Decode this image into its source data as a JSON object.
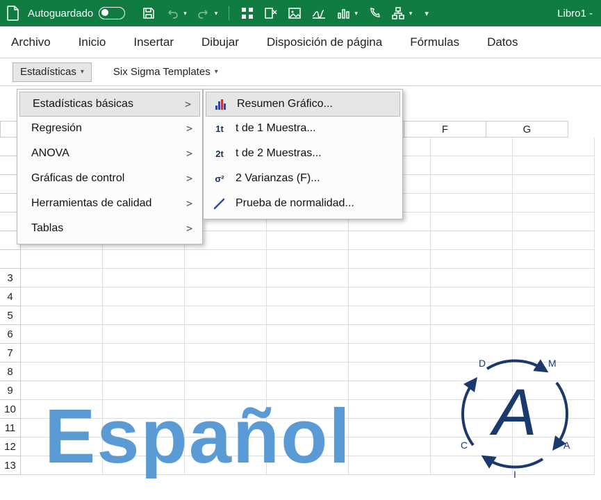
{
  "titlebar": {
    "autosave_label": "Autoguardado",
    "doc_title": "Libro1 -"
  },
  "ribbon_tabs": [
    "Archivo",
    "Inicio",
    "Insertar",
    "Dibujar",
    "Disposición de página",
    "Fórmulas",
    "Datos"
  ],
  "addin": {
    "stats_label": "Estadísticas",
    "templates_label": "Six Sigma Templates"
  },
  "menu1": {
    "items": [
      "Estadísticas básicas",
      "Regresión",
      "ANOVA",
      "Gráficas de control",
      "Herramientas de calidad",
      "Tablas"
    ]
  },
  "menu2": {
    "items": [
      {
        "icon": "hist",
        "label": "Resumen Gráfico..."
      },
      {
        "icon": "1t",
        "label": "t de 1 Muestra..."
      },
      {
        "icon": "2t",
        "label": "t de 2 Muestras..."
      },
      {
        "icon": "σ²",
        "label": "2 Varianzas (F)..."
      },
      {
        "icon": "pen",
        "label": "Prueba de normalidad..."
      }
    ]
  },
  "columns": [
    "F",
    "G"
  ],
  "rows": [
    "3",
    "4",
    "5",
    "6",
    "7",
    "8",
    "9",
    "10",
    "11",
    "12",
    "13"
  ],
  "watermark": "Español",
  "badge_letters": {
    "top_left": "D",
    "top_right": "M",
    "bottom_right": "A",
    "bottom": "I",
    "bottom_left": "C"
  }
}
